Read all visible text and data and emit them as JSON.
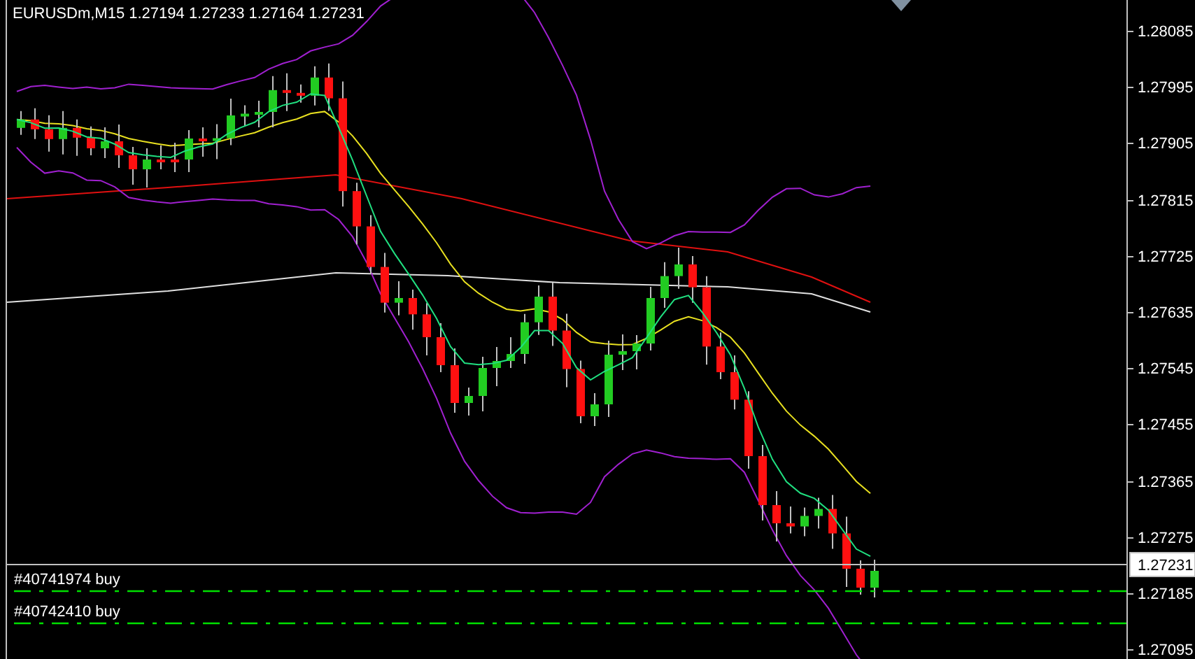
{
  "header": {
    "symbol": "EURUSDm,M15",
    "prices": [
      "1.27194",
      "1.27233",
      "1.27164",
      "1.27231"
    ]
  },
  "price_axis": [
    "1.28085",
    "1.27995",
    "1.27905",
    "1.27815",
    "1.27725",
    "1.27635",
    "1.27545",
    "1.27455",
    "1.27365",
    "1.27275",
    "1.27185",
    "1.27095"
  ],
  "current_price": "1.27231",
  "orders": [
    {
      "label": "#40741974 buy"
    },
    {
      "label": "#40742410 buy"
    }
  ]
}
